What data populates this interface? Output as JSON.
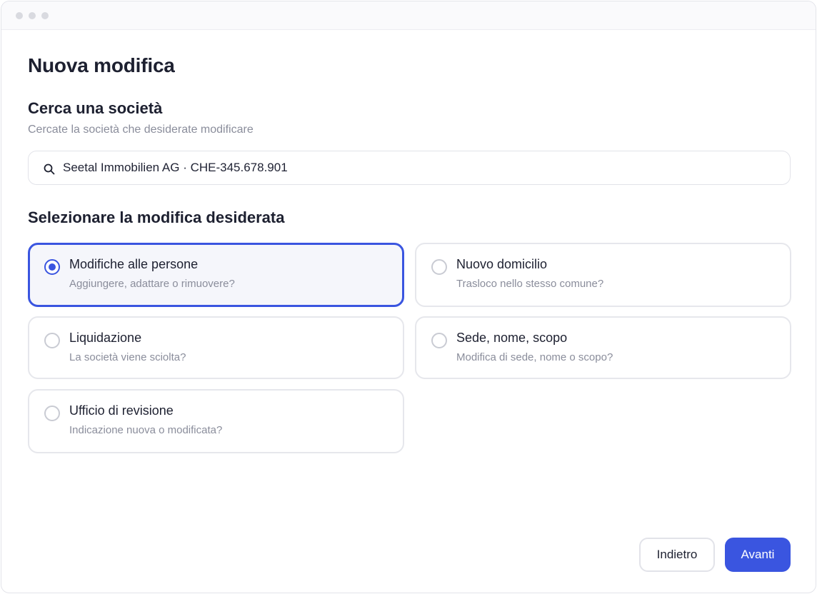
{
  "page": {
    "title": "Nuova modifica"
  },
  "search_section": {
    "title": "Cerca una società",
    "subtitle": "Cercate la società che desiderate modificare",
    "input_value": "Seetal Immobilien AG · CHE-345.678.901"
  },
  "options_section": {
    "title": "Selezionare la modifica desiderata",
    "options": [
      {
        "label": "Modifiche alle persone",
        "description": "Aggiungere, adattare o rimuovere?",
        "selected": true
      },
      {
        "label": "Nuovo domicilio",
        "description": "Trasloco nello stesso comune?",
        "selected": false
      },
      {
        "label": "Liquidazione",
        "description": "La società viene sciolta?",
        "selected": false
      },
      {
        "label": "Sede, nome, scopo",
        "description": "Modifica di sede, nome o scopo?",
        "selected": false
      },
      {
        "label": "Ufficio di revisione",
        "description": "Indicazione nuova o modificata?",
        "selected": false
      }
    ]
  },
  "footer": {
    "back_label": "Indietro",
    "next_label": "Avanti"
  },
  "colors": {
    "accent": "#3a55e0",
    "selected_bg": "#f5f6fb",
    "muted_text": "#8a8d9b"
  }
}
